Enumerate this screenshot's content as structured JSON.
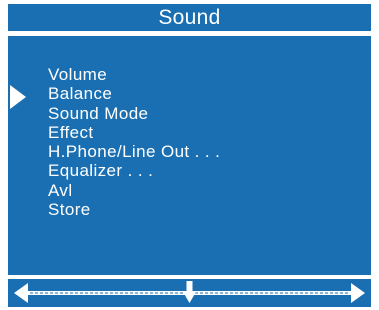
{
  "osd": {
    "title": "Sound",
    "menu_items": [
      "Volume",
      "Balance",
      "Sound Mode",
      "Effect",
      "H.Phone/Line Out . . .",
      "Equalizer . . .",
      "Avl",
      "Store"
    ],
    "selected_item": "Balance",
    "pointer_icon": "triangle-right-icon",
    "balance_slider": {
      "position": 0.5,
      "left_icon": "arrow-left-icon",
      "right_icon": "arrow-right-icon",
      "marker_icon": "arrow-down-icon"
    },
    "colors": {
      "panel": "#1a6fb2",
      "text": "#ffffff",
      "background": "#ffffff"
    }
  }
}
